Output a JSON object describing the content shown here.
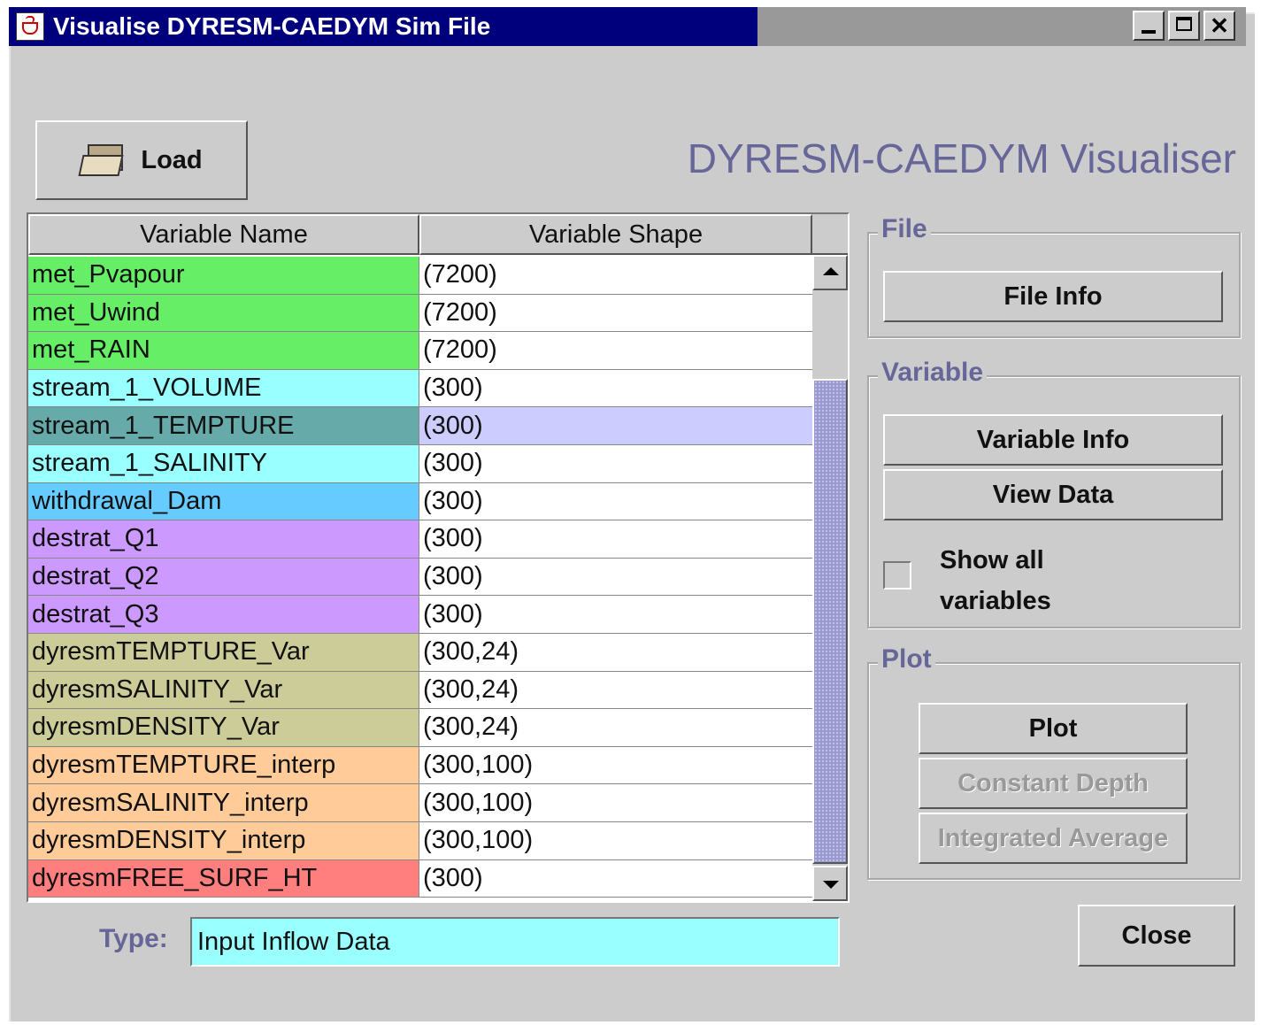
{
  "window": {
    "title": "Visualise DYRESM-CAEDYM Sim File",
    "title_icon": "java-cup-icon",
    "controls": [
      "minimize",
      "maximize",
      "close"
    ],
    "close_glyph": "✕"
  },
  "toolbar": {
    "load_label": "Load",
    "load_icon": "folder-icon"
  },
  "app_title": "DYRESM-CAEDYM Visualiser",
  "table": {
    "columns": [
      "Variable Name",
      "Variable Shape"
    ],
    "selected_index": 4,
    "rows": [
      {
        "name": "met_Pvapour",
        "shape": "(7200)",
        "color": "#66ee66"
      },
      {
        "name": "met_Uwind",
        "shape": "(7200)",
        "color": "#66ee66"
      },
      {
        "name": "met_RAIN",
        "shape": "(7200)",
        "color": "#66ee66"
      },
      {
        "name": "stream_1_VOLUME",
        "shape": "(300)",
        "color": "#99ffff"
      },
      {
        "name": "stream_1_TEMPTURE",
        "shape": "(300)",
        "color": "#66aaaa"
      },
      {
        "name": "stream_1_SALINITY",
        "shape": "(300)",
        "color": "#99ffff"
      },
      {
        "name": "withdrawal_Dam",
        "shape": "(300)",
        "color": "#66ccff"
      },
      {
        "name": "destrat_Q1",
        "shape": "(300)",
        "color": "#cc99ff"
      },
      {
        "name": "destrat_Q2",
        "shape": "(300)",
        "color": "#cc99ff"
      },
      {
        "name": "destrat_Q3",
        "shape": "(300)",
        "color": "#cc99ff"
      },
      {
        "name": "dyresmTEMPTURE_Var",
        "shape": "(300,24)",
        "color": "#cccc99"
      },
      {
        "name": "dyresmSALINITY_Var",
        "shape": "(300,24)",
        "color": "#cccc99"
      },
      {
        "name": "dyresmDENSITY_Var",
        "shape": "(300,24)",
        "color": "#cccc99"
      },
      {
        "name": "dyresmTEMPTURE_interp",
        "shape": "(300,100)",
        "color": "#ffcc99"
      },
      {
        "name": "dyresmSALINITY_interp",
        "shape": "(300,100)",
        "color": "#ffcc99"
      },
      {
        "name": "dyresmDENSITY_interp",
        "shape": "(300,100)",
        "color": "#ffcc99"
      },
      {
        "name": "dyresmFREE_SURF_HT",
        "shape": "(300)",
        "color": "#ff7f7f"
      }
    ],
    "selected_shape_color": "#ccccff"
  },
  "type": {
    "label": "Type:",
    "value": "Input Inflow Data"
  },
  "file_group": {
    "title": "File",
    "file_info_label": "File Info"
  },
  "variable_group": {
    "title": "Variable",
    "variable_info_label": "Variable Info",
    "view_data_label": "View Data",
    "show_all_label": "Show all variables",
    "show_all_checked": false
  },
  "plot_group": {
    "title": "Plot",
    "plot_label": "Plot",
    "constant_depth_label": "Constant Depth",
    "integrated_average_label": "Integrated Average"
  },
  "close_label": "Close",
  "colors": {
    "title_active": "#00007c",
    "accent_text": "#666699",
    "window_bg": "#cccccc"
  }
}
